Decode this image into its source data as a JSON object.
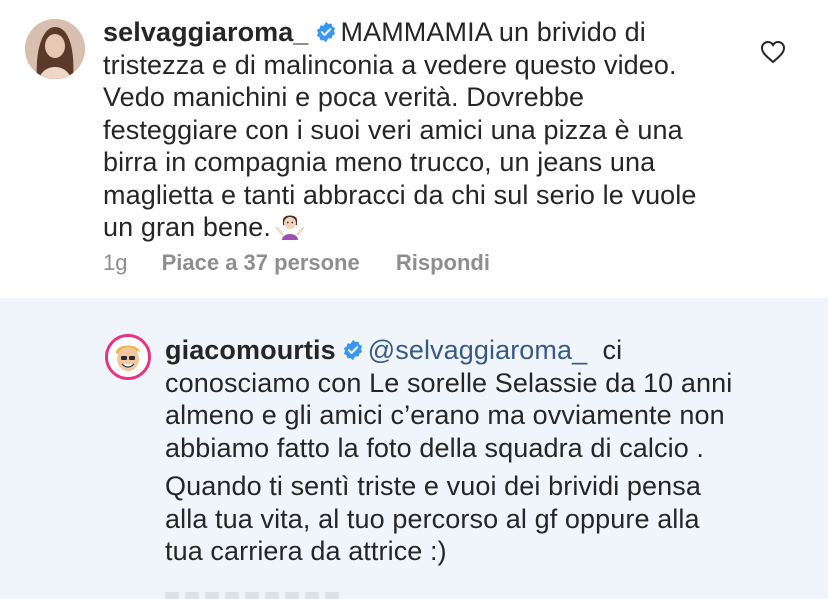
{
  "comment": {
    "username": "selvaggiaroma_",
    "text": "MAMMAMIA un brivido di tristezza e di malinconia a vedere questo video. Vedo manichini e poca verità. Dovrebbe festeggiare con i suoi veri amici una pizza è una birra in compagnia meno trucco, un jeans una maglietta e tanti abbracci da chi sul serio le vuole un gran bene.",
    "emoji": "woman-shrugging-emoji",
    "time": "1g",
    "likes": "Piace a 37 persone",
    "reply_label": "Rispondi"
  },
  "reply": {
    "username": "giacomourtis",
    "mention": "@selvaggiaroma_",
    "text_1": "ci conosciamo con  Le  sorelle Selassie da 10 anni almeno e gli amici c’erano ma ovviamente non abbiamo fatto la foto della squadra di calcio .",
    "text_2": "Quando ti sentì triste e vuoi dei brividi pensa alla tua vita, al  tuo percorso al gf oppure alla tua carriera da attrice :)"
  },
  "colors": {
    "reply_background": "#eff5fa",
    "verified_badge": "#3897f0",
    "meta_text": "#8e8e8e",
    "mention": "#385a86",
    "story_ring": "#e8347f"
  }
}
